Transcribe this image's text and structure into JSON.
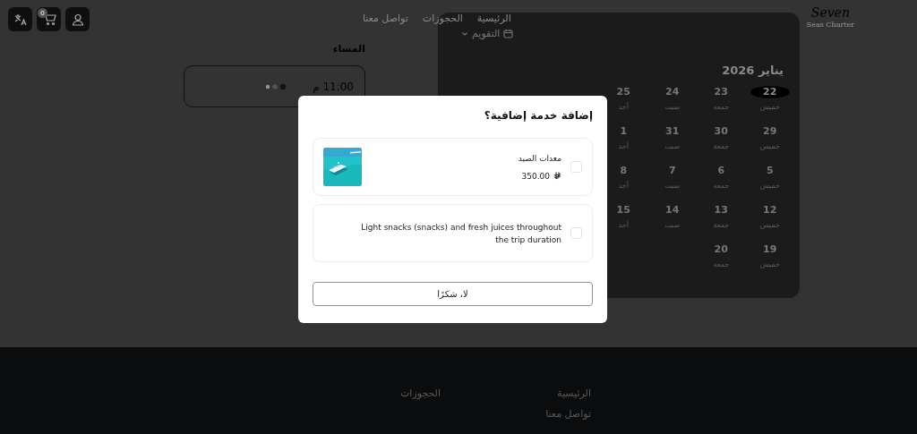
{
  "header": {
    "logo": {
      "title": "Seven",
      "subtitle": "Seas Charter"
    },
    "nav": [
      {
        "label": "الرئيسية"
      },
      {
        "label": "الحجوزات"
      },
      {
        "label": "تواصل معنا"
      }
    ],
    "cart_badge": "0"
  },
  "calendar": {
    "toggle": "التقويم",
    "month": "يناير 2026",
    "weeks": [
      [
        {
          "number": "22",
          "weekday": "خميس",
          "selected": true
        },
        {
          "number": "23",
          "weekday": "جمعة",
          "selected": false
        },
        {
          "number": "24",
          "weekday": "سبت",
          "selected": false
        },
        {
          "number": "25",
          "weekday": "أحد",
          "selected": false
        }
      ],
      [
        {
          "number": "29",
          "weekday": "خميس",
          "selected": false
        },
        {
          "number": "30",
          "weekday": "جمعة",
          "selected": false
        },
        {
          "number": "31",
          "weekday": "سبت",
          "selected": false
        },
        {
          "number": "1",
          "weekday": "أحد",
          "selected": false
        }
      ],
      [
        {
          "number": "5",
          "weekday": "خميس",
          "selected": false
        },
        {
          "number": "6",
          "weekday": "جمعة",
          "selected": false
        },
        {
          "number": "7",
          "weekday": "سبت",
          "selected": false
        },
        {
          "number": "8",
          "weekday": "أحد",
          "selected": false
        }
      ],
      [
        {
          "number": "12",
          "weekday": "خميس",
          "selected": false
        },
        {
          "number": "13",
          "weekday": "جمعة",
          "selected": false
        },
        {
          "number": "14",
          "weekday": "سبت",
          "selected": false
        },
        {
          "number": "15",
          "weekday": "أحد",
          "selected": false
        }
      ],
      [
        {
          "number": "19",
          "weekday": "خميس",
          "selected": false
        },
        {
          "number": "20",
          "weekday": "جمعة",
          "selected": false
        }
      ]
    ]
  },
  "time_slots": {
    "title": "المساء",
    "slots": [
      {
        "time": "11:00 م"
      }
    ]
  },
  "modal": {
    "title": "إضافة خدمة إضافية؟",
    "options": [
      {
        "name": "معدات الصيد",
        "price": "350.00",
        "checked": false
      },
      {
        "kind": "text",
        "name": "Light snacks (snacks) and fresh juices throughout the trip duration",
        "checked": false
      }
    ],
    "dismiss": "لا، شكرًا"
  },
  "footer": {
    "links": [
      {
        "label": "الرئيسية"
      },
      {
        "label": "الحجوزات"
      },
      {
        "label": "تواصل معنا"
      }
    ]
  }
}
